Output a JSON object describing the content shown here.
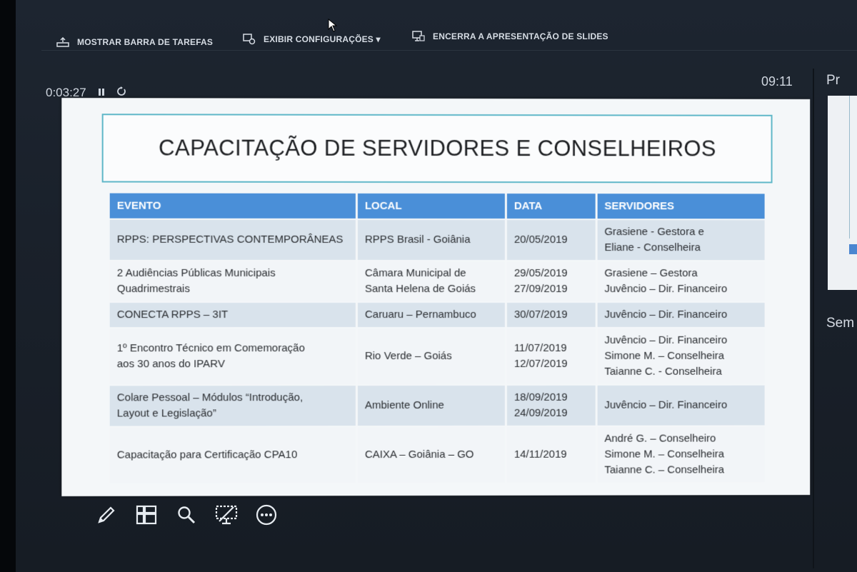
{
  "toolbar": {
    "show_taskbar": "MOSTRAR BARRA DE TAREFAS",
    "display_settings": "EXIBIR CONFIGURAÇÕES ▾",
    "end_slideshow": "ENCERRA A APRESENTAÇÃO DE SLIDES"
  },
  "timer": {
    "elapsed": "0:03:27",
    "pause_icon": "pause-icon",
    "restart_icon": "restart-icon"
  },
  "clock": "09:11",
  "side": {
    "next_label": "Pr",
    "notes_label": "Sem"
  },
  "slide": {
    "title": "CAPACITAÇÃO DE SERVIDORES E CONSELHEIROS",
    "headers": {
      "event": "EVENTO",
      "local": "LOCAL",
      "date": "DATA",
      "staff": "SERVIDORES"
    },
    "rows": [
      {
        "event": [
          "RPPS: PERSPECTIVAS CONTEMPORÂNEAS"
        ],
        "local": [
          "RPPS Brasil - Goiânia"
        ],
        "date": [
          "20/05/2019"
        ],
        "staff": [
          "Grasiene - Gestora e",
          "Eliane - Conselheira"
        ]
      },
      {
        "event": [
          "2 Audiências Públicas Municipais",
          "Quadrimestrais"
        ],
        "local": [
          "Câmara Municipal de",
          "Santa Helena de Goiás"
        ],
        "date": [
          "29/05/2019",
          "27/09/2019"
        ],
        "staff": [
          "Grasiene – Gestora",
          "Juvêncio – Dir. Financeiro"
        ]
      },
      {
        "event": [
          "CONECTA RPPS – 3IT"
        ],
        "local": [
          "Caruaru – Pernambuco"
        ],
        "date": [
          "30/07/2019"
        ],
        "staff": [
          "Juvêncio – Dir. Financeiro"
        ]
      },
      {
        "event": [
          "1º Encontro Técnico em Comemoração",
          "aos 30 anos do IPARV"
        ],
        "local": [
          "Rio Verde – Goiás"
        ],
        "date": [
          "11/07/2019",
          "12/07/2019"
        ],
        "staff": [
          "Juvêncio – Dir. Financeiro",
          "Simone M. – Conselheira",
          "Taianne C. - Conselheira"
        ]
      },
      {
        "event": [
          "Colare Pessoal – Módulos “Introdução,",
          "Layout e Legislação”"
        ],
        "local": [
          "Ambiente Online"
        ],
        "date": [
          "18/09/2019",
          "24/09/2019"
        ],
        "staff": [
          "Juvêncio – Dir. Financeiro"
        ]
      },
      {
        "event": [
          "Capacitação para Certificação CPA10"
        ],
        "local": [
          "CAIXA – Goiânia – GO"
        ],
        "date": [
          "14/11/2019"
        ],
        "staff": [
          "André G. – Conselheiro",
          "Simone M. – Conselheira",
          "Taianne C. – Conselheira"
        ]
      }
    ]
  },
  "tools": [
    "pen-icon",
    "slides-grid-icon",
    "zoom-icon",
    "black-screen-icon",
    "more-options-icon"
  ]
}
